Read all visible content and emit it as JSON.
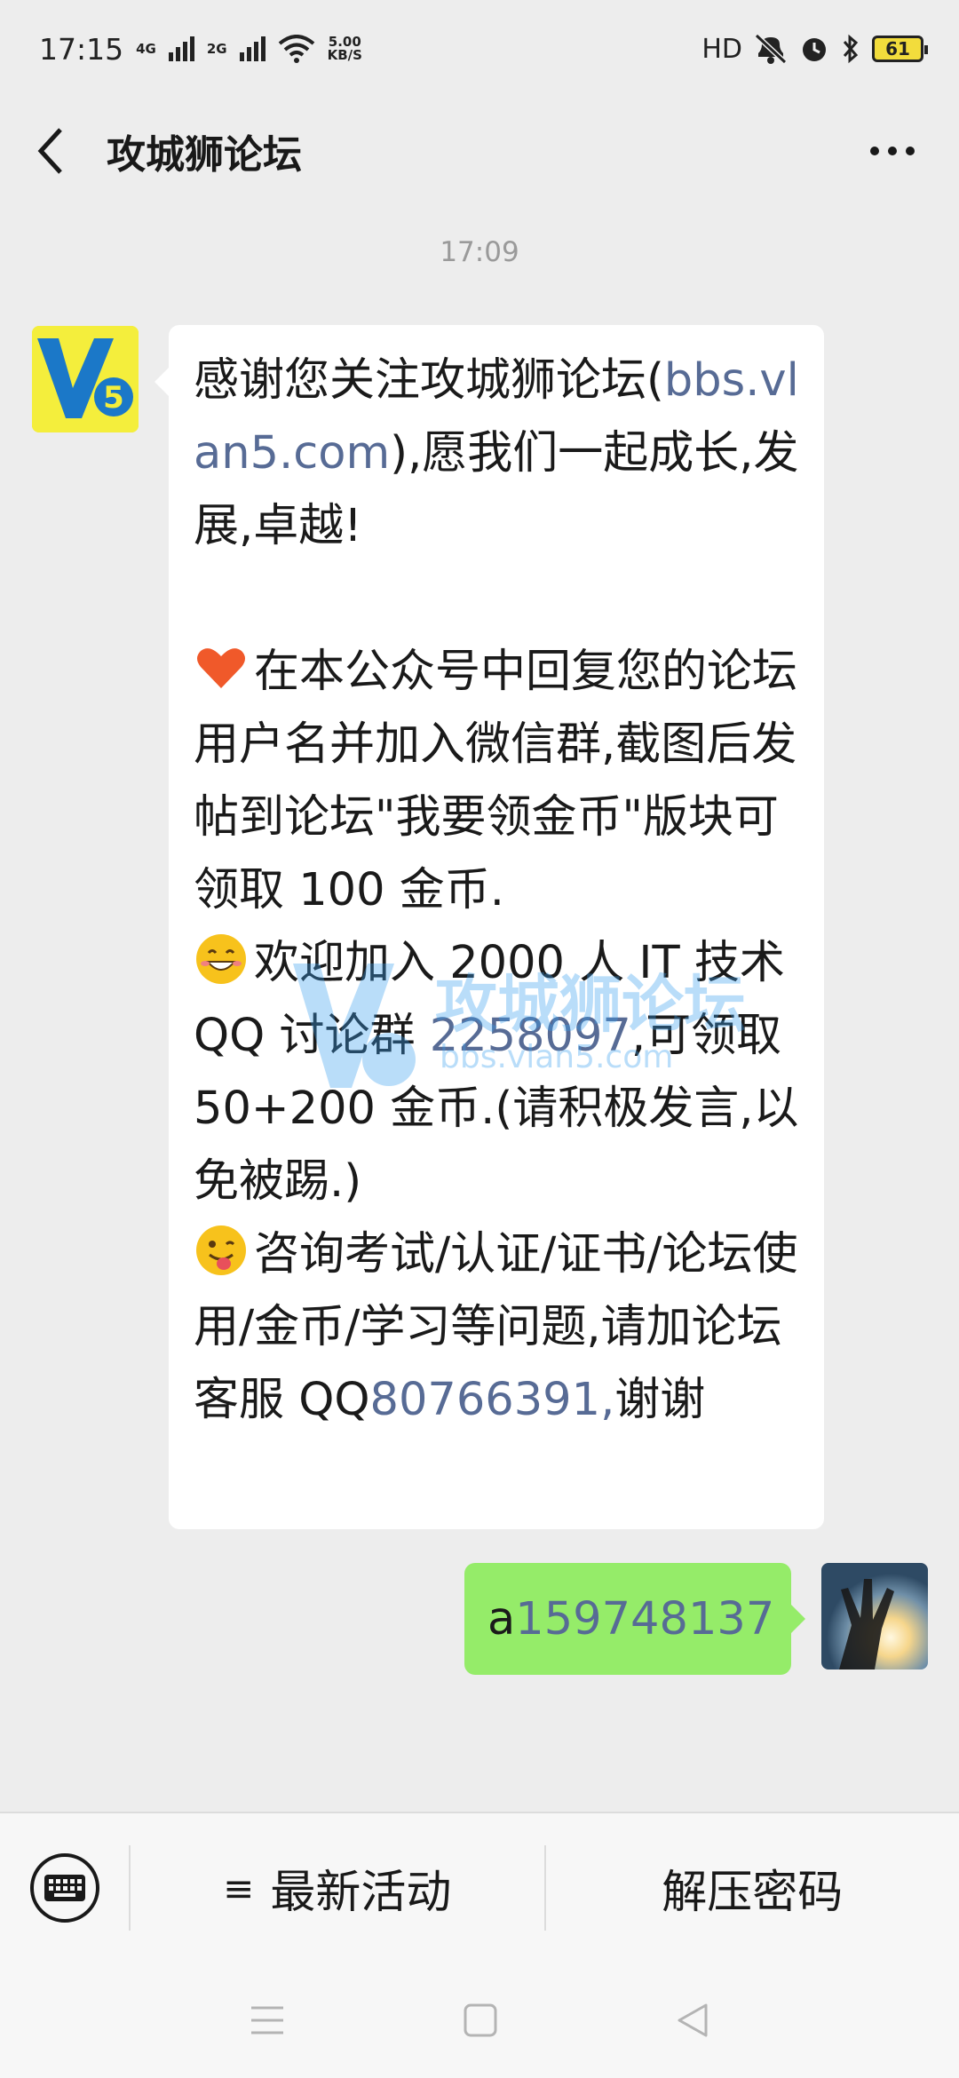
{
  "status_bar": {
    "time": "17:15",
    "net1": "4G",
    "net2": "2G",
    "speed_value": "5.00",
    "speed_unit": "KB/S",
    "hd": "HD",
    "battery": "61"
  },
  "nav": {
    "title": "攻城狮论坛"
  },
  "chat": {
    "timestamp": "17:09",
    "incoming": {
      "p1_a": "感谢您关注攻城狮论坛(",
      "p1_link": "bbs.vlan5.com",
      "p1_b": "),愿我们一起成长,发展,卓越!",
      "p2": "在本公众号中回复您的论坛用户名并加入微信群,截图后发帖到论坛\"我要领金币\"版块可领取 100 金币.",
      "p3_a": "欢迎加入 2000 人 IT 技术 QQ 讨论群 ",
      "p3_link": "2258097",
      "p3_b": ",可领取 50+200 金币.(请积极发言,以免被踢.)",
      "p4_a": "咨询考试/认证/证书/论坛使用/金币/学习等问题,请加论坛客服 QQ",
      "p4_link": "80766391,",
      "p4_b": "谢谢"
    },
    "outgoing": {
      "prefix": "a",
      "number": "159748137"
    },
    "watermark": {
      "text": "攻城狮论坛",
      "sub": "bbs.vlan5.com"
    }
  },
  "bottom_menu": {
    "items": [
      {
        "label": "最新活动",
        "icon": "≡"
      },
      {
        "label": "解压密码"
      }
    ]
  },
  "colors": {
    "link": "#576b95",
    "outgoing_bubble": "#95ec69",
    "incoming_bubble": "#ffffff",
    "background": "#ededed"
  }
}
